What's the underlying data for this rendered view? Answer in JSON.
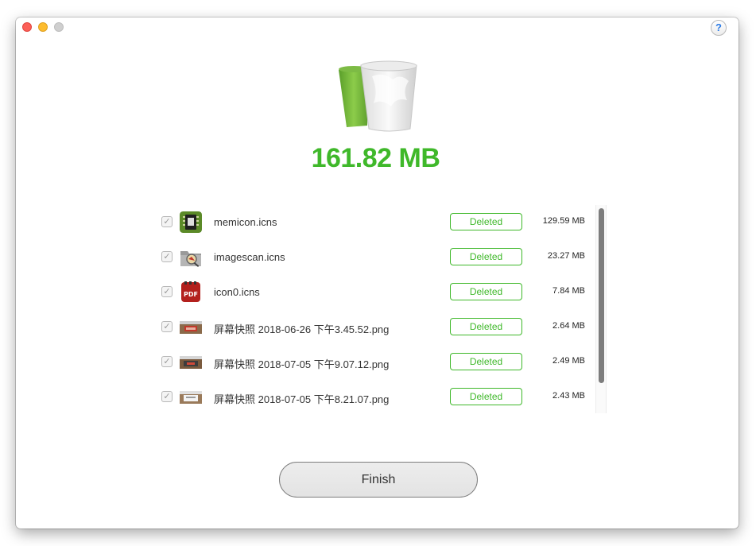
{
  "window": {
    "help_label": "?"
  },
  "summary": {
    "total_size": "161.82 MB"
  },
  "files": [
    {
      "name": "memicon.icns",
      "status": "Deleted",
      "size": "129.59 MB",
      "checked": true,
      "icon": "memory-chip-icon"
    },
    {
      "name": "imagescan.icns",
      "status": "Deleted",
      "size": "23.27 MB",
      "checked": true,
      "icon": "image-folder-icon"
    },
    {
      "name": "icon0.icns",
      "status": "Deleted",
      "size": "7.84 MB",
      "checked": true,
      "icon": "pdf-icon"
    },
    {
      "name": "屏幕快照 2018-06-26 下午3.45.52.png",
      "status": "Deleted",
      "size": "2.64 MB",
      "checked": true,
      "icon": "screenshot-thumbnail-icon"
    },
    {
      "name": "屏幕快照 2018-07-05 下午9.07.12.png",
      "status": "Deleted",
      "size": "2.49 MB",
      "checked": true,
      "icon": "screenshot-thumbnail-icon"
    },
    {
      "name": "屏幕快照 2018-07-05 下午8.21.07.png",
      "status": "Deleted",
      "size": "2.43 MB",
      "checked": true,
      "icon": "screenshot-thumbnail-icon"
    }
  ],
  "checkbox_mark": "✓",
  "actions": {
    "finish_label": "Finish"
  },
  "colors": {
    "accent_green": "#3fb82a"
  }
}
